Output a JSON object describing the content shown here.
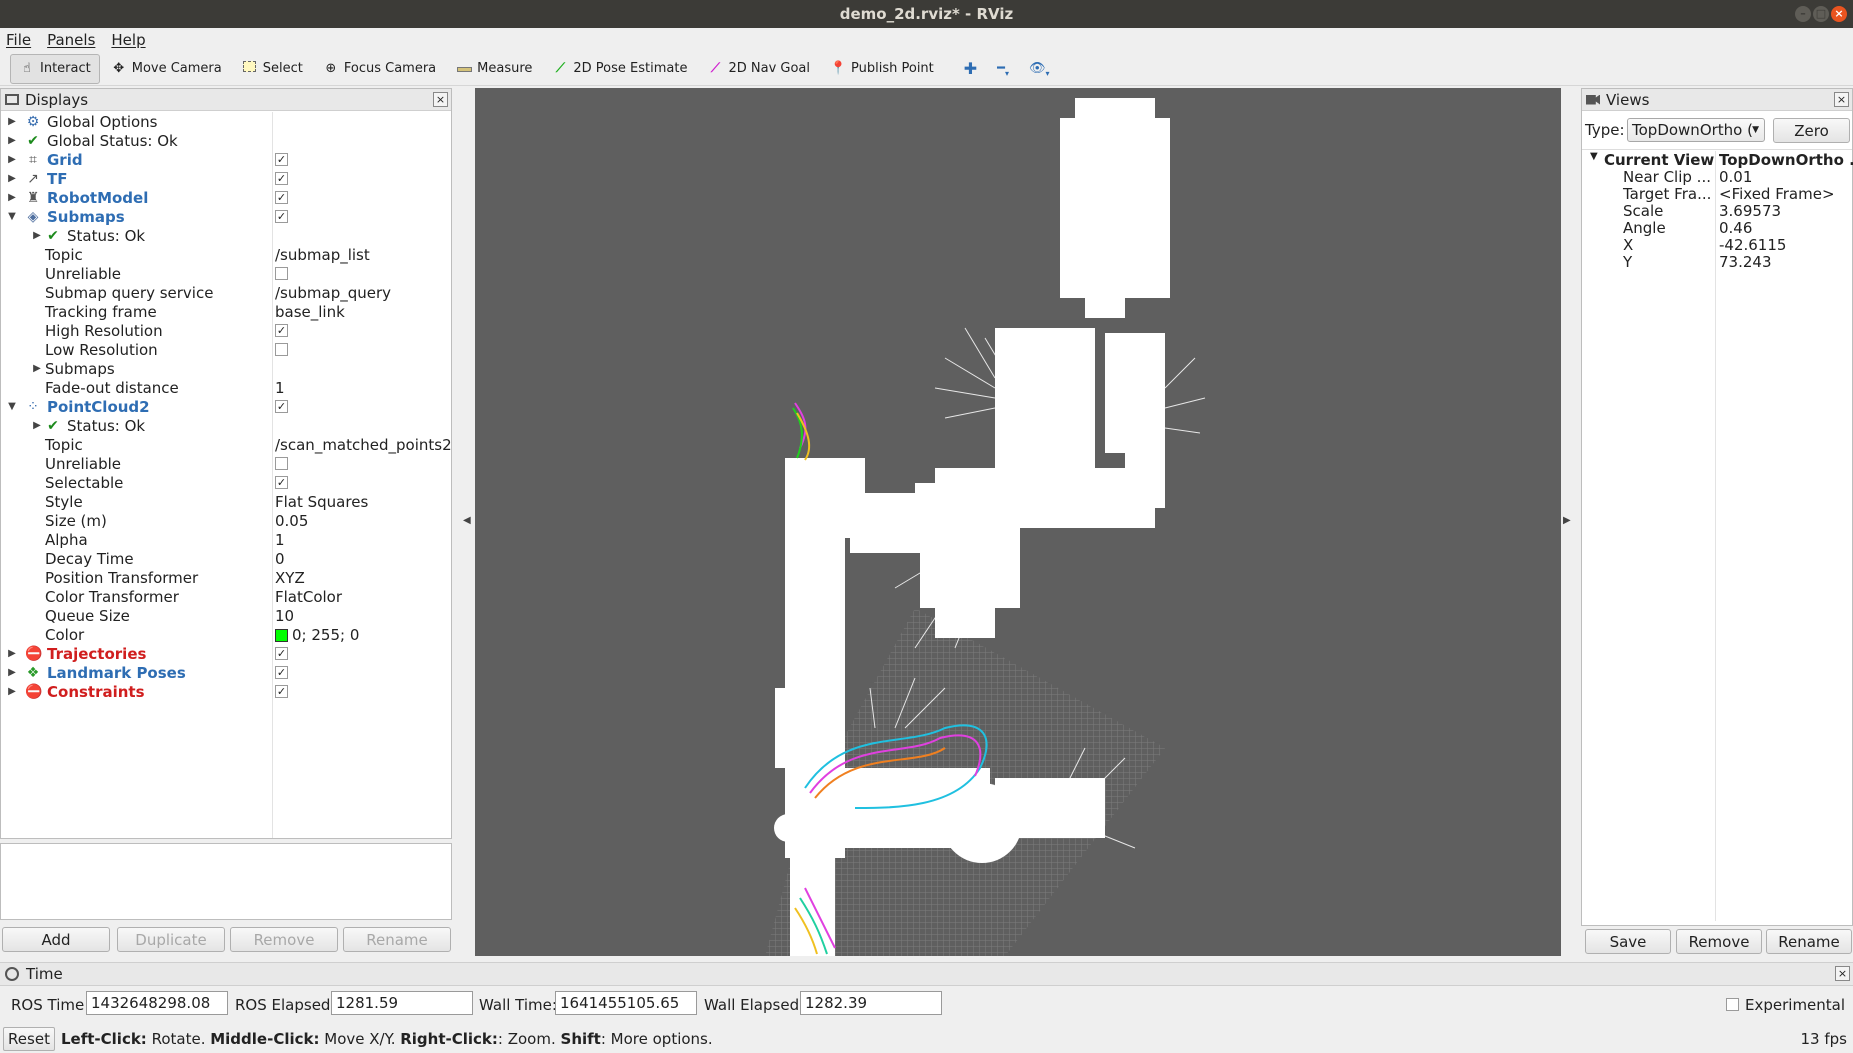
{
  "window": {
    "title": "demo_2d.rviz* - RViz"
  },
  "menu": [
    "File",
    "Panels",
    "Help"
  ],
  "toolbar": {
    "tools": [
      {
        "label": "Interact",
        "icon": "hand-icon",
        "active": true
      },
      {
        "label": "Move Camera",
        "icon": "move-camera-icon",
        "active": false
      },
      {
        "label": "Select",
        "icon": "select-icon",
        "active": false
      },
      {
        "label": "Focus Camera",
        "icon": "focus-camera-icon",
        "active": false
      },
      {
        "label": "Measure",
        "icon": "ruler-icon",
        "active": false
      },
      {
        "label": "2D Pose Estimate",
        "icon": "green-arrow-icon",
        "active": false
      },
      {
        "label": "2D Nav Goal",
        "icon": "magenta-arrow-icon",
        "active": false
      },
      {
        "label": "Publish Point",
        "icon": "map-pin-icon",
        "active": false
      }
    ]
  },
  "displays": {
    "title": "Displays",
    "rows": [
      {
        "label": "Global Options",
        "level": 0,
        "expander": "closed",
        "icon": "gear-icon",
        "style": "normal"
      },
      {
        "label": "Global Status: Ok",
        "level": 0,
        "expander": "closed",
        "icon": "check-icon",
        "style": "normal"
      },
      {
        "label": "Grid",
        "level": 0,
        "expander": "closed",
        "icon": "grid-icon",
        "style": "blue",
        "checked": true
      },
      {
        "label": "TF",
        "level": 0,
        "expander": "closed",
        "icon": "tf-icon",
        "style": "blue",
        "checked": true
      },
      {
        "label": "RobotModel",
        "level": 0,
        "expander": "closed",
        "icon": "robot-icon",
        "style": "blue",
        "checked": true
      },
      {
        "label": "Submaps",
        "level": 0,
        "expander": "open",
        "icon": "submaps-icon",
        "style": "blue",
        "checked": true
      },
      {
        "label": "Status: Ok",
        "level": 1,
        "expander": "closed",
        "icon": "check-icon",
        "style": "normal"
      },
      {
        "label": "Topic",
        "level": 1,
        "value": "/submap_list"
      },
      {
        "label": "Unreliable",
        "level": 1,
        "checked": false
      },
      {
        "label": "Submap query service",
        "level": 1,
        "value": "/submap_query"
      },
      {
        "label": "Tracking frame",
        "level": 1,
        "value": "base_link"
      },
      {
        "label": "High Resolution",
        "level": 1,
        "checked": true
      },
      {
        "label": "Low Resolution",
        "level": 1,
        "checked": false
      },
      {
        "label": "Submaps",
        "level": 1,
        "expander": "closed"
      },
      {
        "label": "Fade-out distance",
        "level": 1,
        "value": "1"
      },
      {
        "label": "PointCloud2",
        "level": 0,
        "expander": "open",
        "icon": "pointcloud-icon",
        "style": "blue",
        "checked": true
      },
      {
        "label": "Status: Ok",
        "level": 1,
        "expander": "closed",
        "icon": "check-icon",
        "style": "normal"
      },
      {
        "label": "Topic",
        "level": 1,
        "value": "/scan_matched_points2"
      },
      {
        "label": "Unreliable",
        "level": 1,
        "checked": false
      },
      {
        "label": "Selectable",
        "level": 1,
        "checked": true
      },
      {
        "label": "Style",
        "level": 1,
        "value": "Flat Squares"
      },
      {
        "label": "Size (m)",
        "level": 1,
        "value": "0.05"
      },
      {
        "label": "Alpha",
        "level": 1,
        "value": "1"
      },
      {
        "label": "Decay Time",
        "level": 1,
        "value": "0"
      },
      {
        "label": "Position Transformer",
        "level": 1,
        "value": "XYZ"
      },
      {
        "label": "Color Transformer",
        "level": 1,
        "value": "FlatColor"
      },
      {
        "label": "Queue Size",
        "level": 1,
        "value": "10"
      },
      {
        "label": "Color",
        "level": 1,
        "value": "0; 255; 0",
        "swatch": "#00ff00"
      },
      {
        "label": "Trajectories",
        "level": 0,
        "expander": "closed",
        "icon": "error-icon",
        "style": "red",
        "checked": true
      },
      {
        "label": "Landmark Poses",
        "level": 0,
        "expander": "closed",
        "icon": "landmark-icon",
        "style": "blue",
        "checked": true
      },
      {
        "label": "Constraints",
        "level": 0,
        "expander": "closed",
        "icon": "error-icon",
        "style": "red",
        "checked": true
      }
    ],
    "buttons": {
      "add": "Add",
      "duplicate": "Duplicate",
      "remove": "Remove",
      "rename": "Rename"
    }
  },
  "views": {
    "title": "Views",
    "type_label": "Type:",
    "type_value": "TopDownOrtho (",
    "zero_label": "Zero",
    "current_view": {
      "label": "Current View",
      "value": "TopDownOrtho ..."
    },
    "props": [
      {
        "label": "Near Clip ...",
        "value": "0.01"
      },
      {
        "label": "Target Fra...",
        "value": "<Fixed Frame>"
      },
      {
        "label": "Scale",
        "value": "3.69573"
      },
      {
        "label": "Angle",
        "value": "0.46"
      },
      {
        "label": "X",
        "value": "-42.6115"
      },
      {
        "label": "Y",
        "value": "73.243"
      }
    ],
    "buttons": {
      "save": "Save",
      "remove": "Remove",
      "rename": "Rename"
    }
  },
  "time": {
    "title": "Time",
    "ros_time_label": "ROS Time:",
    "ros_time": "1432648298.08",
    "ros_elapsed_label": "ROS Elapsed:",
    "ros_elapsed": "1281.59",
    "wall_time_label": "Wall Time:",
    "wall_time": "1641455105.65",
    "wall_elapsed_label": "Wall Elapsed:",
    "wall_elapsed": "1282.39",
    "experimental_label": "Experimental"
  },
  "status": {
    "reset_label": "Reset",
    "help_left_key": "Left-Click:",
    "help_left": " Rotate. ",
    "help_mid_key": "Middle-Click:",
    "help_mid": " Move X/Y. ",
    "help_right_key": "Right-Click:",
    "help_right": ": Zoom. ",
    "help_shift_key": "Shift",
    "help_shift": ": More options.",
    "fps": "13 fps"
  }
}
